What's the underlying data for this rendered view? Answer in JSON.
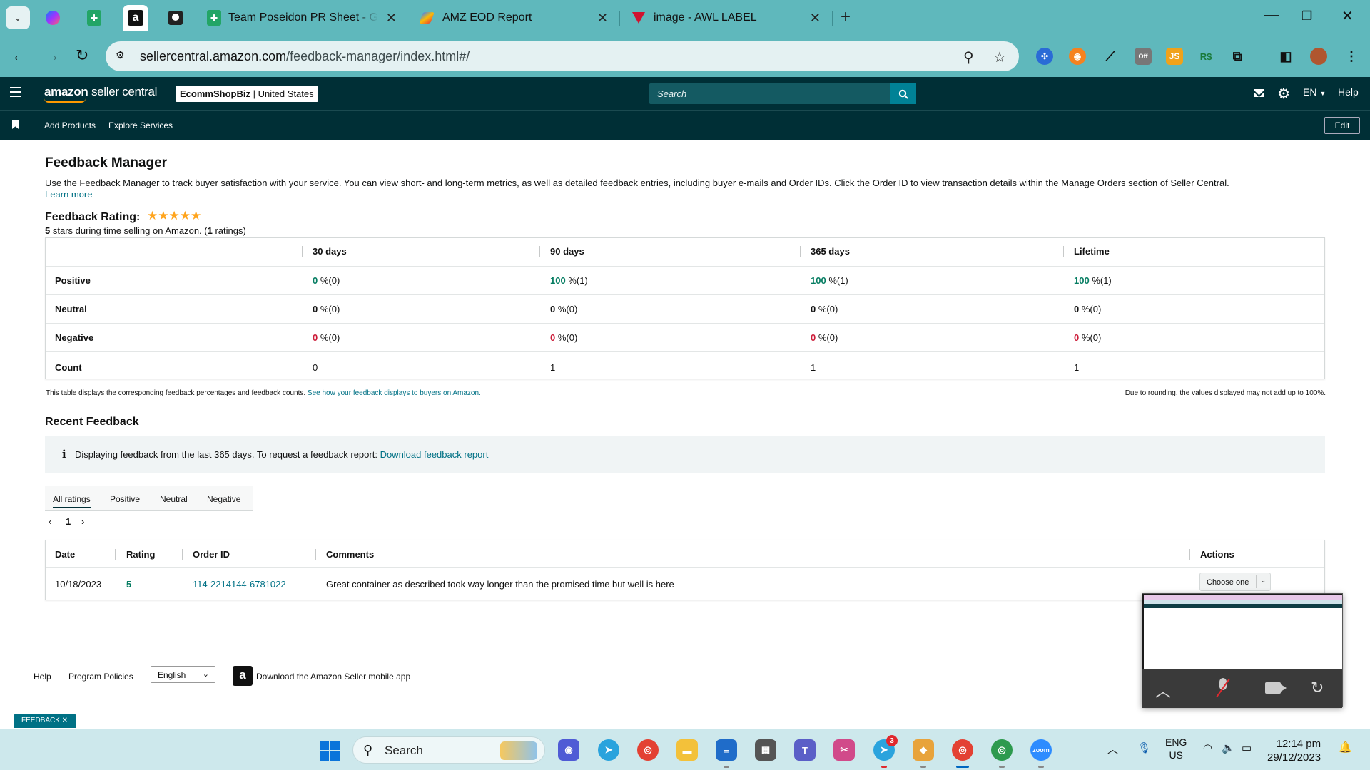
{
  "browser": {
    "tabs": [
      {
        "title": "Team Poseidon PR Sheet - Goo"
      },
      {
        "title": "AMZ EOD Report"
      },
      {
        "title": "image - AWL LABEL"
      }
    ],
    "url_host": "sellercentral.amazon.com",
    "url_path": "/feedback-manager/index.html#/"
  },
  "header": {
    "logo_brand": "amazon",
    "logo_product": "seller central",
    "store_name": "EcommShopBiz",
    "store_region": "United States",
    "search_placeholder": "Search",
    "language": "EN",
    "help": "Help"
  },
  "subnav": {
    "links": [
      "Add Products",
      "Explore Services"
    ],
    "edit": "Edit"
  },
  "page": {
    "title": "Feedback Manager",
    "description": "Use the Feedback Manager to track buyer satisfaction with your service. You can view short- and long-term metrics, as well as detailed feedback entries, including buyer e-mails and Order IDs. Click the Order ID to view transaction details within the Manage Orders section of Seller Central.",
    "learn_more": "Learn more",
    "rating_title": "Feedback Rating:",
    "stars": "★★★★★",
    "rating_stars": "5",
    "rating_text": " stars during time selling on Amazon. (",
    "rating_count": "1",
    "rating_suffix": " ratings)"
  },
  "summary_table": {
    "headers": [
      "30 days",
      "90 days",
      "365 days",
      "Lifetime"
    ],
    "rows": [
      {
        "label": "Positive",
        "cells": [
          {
            "v": "0",
            "s": " %(0)"
          },
          {
            "v": "100",
            "s": " %(1)"
          },
          {
            "v": "100",
            "s": " %(1)"
          },
          {
            "v": "100",
            "s": " %(1)"
          }
        ]
      },
      {
        "label": "Neutral",
        "cells": [
          {
            "v": "0",
            "s": " %(0)"
          },
          {
            "v": "0",
            "s": " %(0)"
          },
          {
            "v": "0",
            "s": " %(0)"
          },
          {
            "v": "0",
            "s": " %(0)"
          }
        ]
      },
      {
        "label": "Negative",
        "cells": [
          {
            "v": "0",
            "s": " %(0)"
          },
          {
            "v": "0",
            "s": " %(0)"
          },
          {
            "v": "0",
            "s": " %(0)"
          },
          {
            "v": "0",
            "s": " %(0)"
          }
        ]
      },
      {
        "label": "Count",
        "cells": [
          {
            "v": "0",
            "s": ""
          },
          {
            "v": "1",
            "s": ""
          },
          {
            "v": "1",
            "s": ""
          },
          {
            "v": "1",
            "s": ""
          }
        ]
      }
    ],
    "note": "This table displays the corresponding feedback percentages and feedback counts. ",
    "note_link": "See how your feedback displays to buyers on Amazon.",
    "note_right": "Due to rounding, the values displayed may not add up to 100%."
  },
  "recent": {
    "title": "Recent Feedback",
    "info": "Displaying feedback from the last 365 days. To request a feedback report: ",
    "info_link": "Download feedback report",
    "tabs": [
      "All ratings",
      "Positive",
      "Neutral",
      "Negative"
    ],
    "page": "1",
    "columns": [
      "Date",
      "Rating",
      "Order ID",
      "Comments",
      "Actions"
    ],
    "rows": [
      {
        "date": "10/18/2023",
        "rating": "5",
        "order_id": "114-2214144-6781022",
        "comment": "Great container as described took way longer than the promised time but well is here",
        "action": "Choose one"
      }
    ]
  },
  "footer": {
    "help": "Help",
    "policies": "Program Policies",
    "language": "English",
    "app_text": "Download the Amazon Seller mobile app",
    "feedback_badge": "FEEDBACK ✕"
  },
  "taskbar": {
    "search": "Search",
    "telegram_badge": "3",
    "lang_top": "ENG",
    "lang_bottom": "US",
    "time": "12:14 pm",
    "date": "29/12/2023"
  },
  "colors": {
    "tab_strip": "#5fb8bc",
    "seller_header": "#002f36",
    "link": "#007185",
    "positive": "#067d62",
    "negative": "#cc1c39",
    "star": "#ffa41c"
  }
}
